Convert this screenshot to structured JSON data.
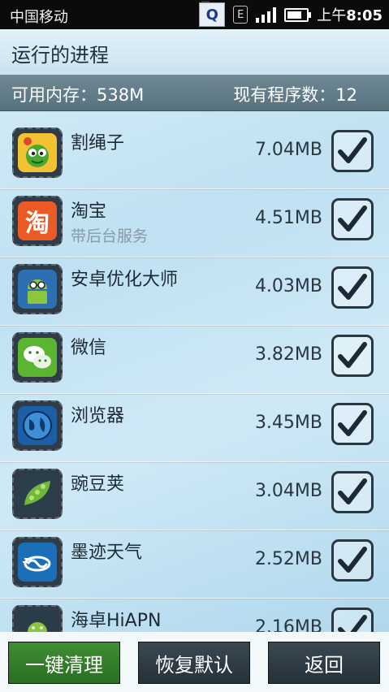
{
  "status_bar": {
    "carrier": "中国移动",
    "network_type": "E",
    "time_prefix": "上午",
    "time": "8:05",
    "icons": [
      "notification-q-icon",
      "network-e-icon",
      "signal-icon",
      "battery-icon"
    ]
  },
  "header": {
    "title": "运行的进程"
  },
  "info": {
    "available_memory": "可用内存：538M",
    "program_count": "现有程序数：12"
  },
  "processes": [
    {
      "name": "割绳子",
      "subtitle": "",
      "size": "7.04MB",
      "checked": true,
      "icon": "cut-the-rope-icon"
    },
    {
      "name": "淘宝",
      "subtitle": "带后台服务",
      "size": "4.51MB",
      "checked": true,
      "icon": "taobao-icon",
      "icon_text": "淘"
    },
    {
      "name": "安卓优化大师",
      "subtitle": "",
      "size": "4.03MB",
      "checked": true,
      "icon": "android-optimizer-icon"
    },
    {
      "name": "微信",
      "subtitle": "",
      "size": "3.82MB",
      "checked": true,
      "icon": "wechat-icon"
    },
    {
      "name": "浏览器",
      "subtitle": "",
      "size": "3.45MB",
      "checked": true,
      "icon": "browser-globe-icon"
    },
    {
      "name": "豌豆荚",
      "subtitle": "",
      "size": "3.04MB",
      "checked": true,
      "icon": "wandoujia-pea-icon"
    },
    {
      "name": "墨迹天气",
      "subtitle": "",
      "size": "2.52MB",
      "checked": true,
      "icon": "moji-weather-icon"
    },
    {
      "name": "海卓HiAPN",
      "subtitle": "",
      "size": "2.16MB",
      "checked": true,
      "icon": "hiapn-android-icon"
    }
  ],
  "buttons": {
    "clean": "一键清理",
    "restore": "恢复默认",
    "back": "返回"
  },
  "colors": {
    "clean_button": "#2f7a27",
    "dark_button": "#2e3b44",
    "info_bar": "#627c88"
  }
}
